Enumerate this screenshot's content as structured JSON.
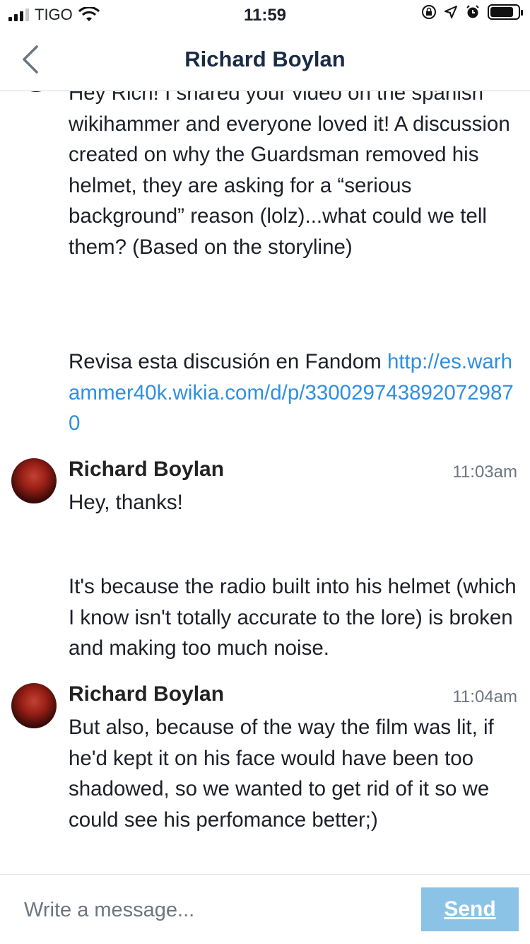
{
  "status_bar": {
    "carrier": "TIGO",
    "time": "11:59",
    "signal_bars_active": 3,
    "battery_level": 0.85
  },
  "header": {
    "title": "Richard Boylan",
    "back_icon": "chevron-left-icon"
  },
  "messages": [
    {
      "text": "Hey Rich! I shared your video on the spanish wikihammer and everyone loved it! A discussion created on why the Guardsman removed his helmet, they are asking for a “serious background” reason (lolz)...what could we tell them? (Based on the storyline)",
      "link_prefix": "Revisa esta discusión en Fandom ",
      "link": "http://es.warhammer40k.wikia.com/d/p/3300297438920729870"
    },
    {
      "sender": "Richard Boylan",
      "time": "11:03am",
      "text": "Hey, thanks!",
      "text2": "It's because the radio built into his helmet (which I know isn't totally accurate to the lore) is broken and making too much noise."
    },
    {
      "sender": "Richard Boylan",
      "time": "11:04am",
      "text": "But also, because of the way the film was lit, if he'd kept it on his face would have been too shadowed, so we wanted to get rid of it so we could see his perfomance better;)"
    }
  ],
  "composer": {
    "placeholder": "Write a message...",
    "send_label": "Send"
  },
  "colors": {
    "header_title": "#1a2b45",
    "link": "#2f8fe3",
    "send_button_bg": "#8bc3e6"
  }
}
